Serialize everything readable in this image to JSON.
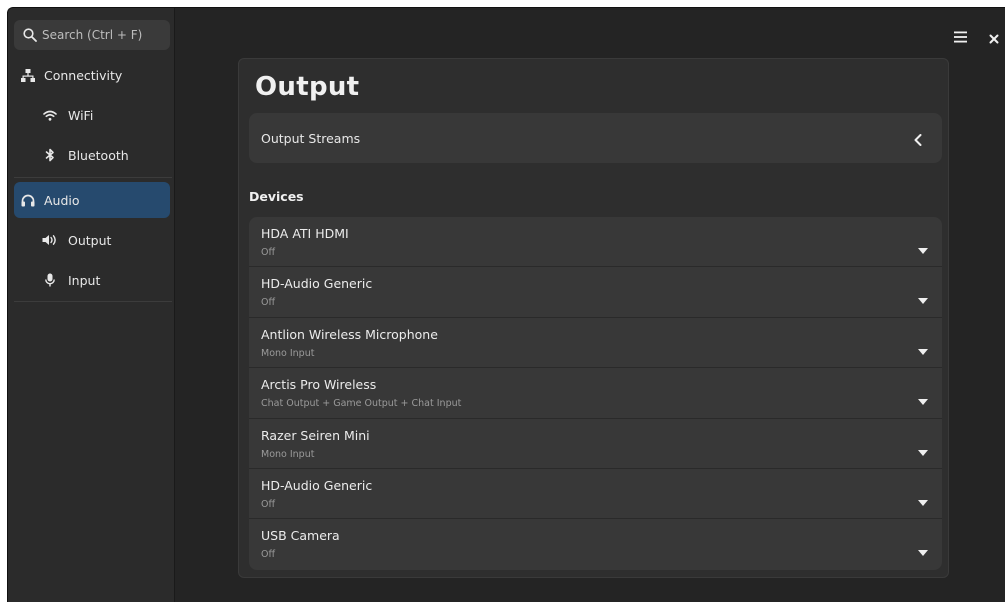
{
  "search": {
    "placeholder": "Search (Ctrl + F)"
  },
  "sidebar": {
    "items": [
      {
        "label": "Connectivity",
        "icon": "network-icon"
      },
      {
        "label": "WiFi",
        "icon": "wifi-icon"
      },
      {
        "label": "Bluetooth",
        "icon": "bluetooth-icon"
      },
      {
        "label": "Audio",
        "icon": "headphones-icon",
        "active": true
      },
      {
        "label": "Output",
        "icon": "speaker-icon"
      },
      {
        "label": "Input",
        "icon": "microphone-icon"
      }
    ]
  },
  "header": {
    "menu_icon": "hamburger-icon",
    "close_icon": "close-icon"
  },
  "main": {
    "title": "Output",
    "streams_label": "Output Streams",
    "devices_heading": "Devices",
    "devices": [
      {
        "name": "HDA ATI HDMI",
        "status": "Off"
      },
      {
        "name": "HD-Audio Generic",
        "status": "Off"
      },
      {
        "name": "Antlion Wireless Microphone",
        "status": "Mono Input"
      },
      {
        "name": "Arctis Pro Wireless",
        "status": "Chat Output + Game Output + Chat Input"
      },
      {
        "name": "Razer Seiren Mini",
        "status": "Mono Input"
      },
      {
        "name": "HD-Audio Generic",
        "status": "Off"
      },
      {
        "name": "USB Camera",
        "status": "Off"
      }
    ]
  },
  "colors": {
    "accent": "#264a6e",
    "background": "#242424",
    "card": "#383838"
  }
}
